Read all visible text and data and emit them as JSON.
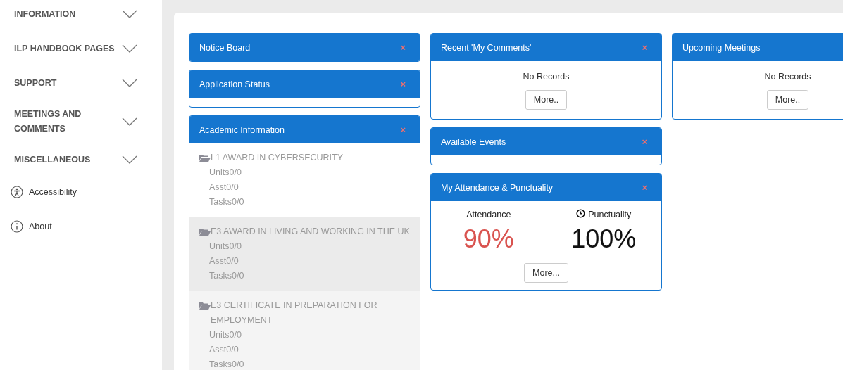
{
  "sidebar": {
    "sections": [
      {
        "label": "INFORMATION",
        "expanded": false
      },
      {
        "label": "ILP HANDBOOK PAGES",
        "expanded": false
      },
      {
        "label": "SUPPORT",
        "expanded": false
      },
      {
        "label": "MEETINGS AND COMMENTS",
        "expanded": false
      },
      {
        "label": "MISCELLANEOUS",
        "expanded": false
      }
    ],
    "links": [
      {
        "label": "Accessibility",
        "kind": "accessibility"
      },
      {
        "label": "About",
        "kind": "info"
      }
    ]
  },
  "columns": [
    [
      {
        "title": "Notice Board",
        "kind": "header",
        "close": "×"
      },
      {
        "title": "Application Status",
        "kind": "empty",
        "close": "×"
      },
      {
        "title": "Academic Information",
        "kind": "courses",
        "close": "×",
        "courses": [
          {
            "name": "L1 AWARD IN CYBERSECURITY",
            "kind": "plain",
            "stats": [
              "Units0/0",
              "Asst0/0",
              "Tasks0/0"
            ]
          },
          {
            "name": "E3 AWARD IN LIVING AND WORKING IN THE UK",
            "kind": "highlighted",
            "stats": [
              "Units0/0",
              "Asst0/0",
              "Tasks0/0"
            ]
          },
          {
            "name": "E3 CERTIFICATE IN PREPARATION FOR EMPLOYMENT",
            "kind": "muted",
            "stats": [
              "Units0/0",
              "Asst0/0",
              "Tasks0/0"
            ]
          }
        ]
      }
    ],
    [
      {
        "title": "Recent 'My Comments'",
        "kind": "records",
        "close": "×",
        "message": "No Records",
        "button": "More.."
      },
      {
        "title": "Available Events",
        "kind": "empty",
        "close": "×"
      },
      {
        "title": "My Attendance & Punctuality",
        "kind": "attendance",
        "close": "×",
        "metrics": [
          {
            "label": "Attendance",
            "value": "90%",
            "color": "#d9534f",
            "icon": false
          },
          {
            "label": "Punctuality",
            "value": "100%",
            "color": "#111111",
            "icon": true
          }
        ],
        "button": "More..."
      }
    ],
    [
      {
        "title": "Upcoming Meetings",
        "kind": "records",
        "message": "No Records",
        "button": "More.."
      }
    ]
  ]
}
